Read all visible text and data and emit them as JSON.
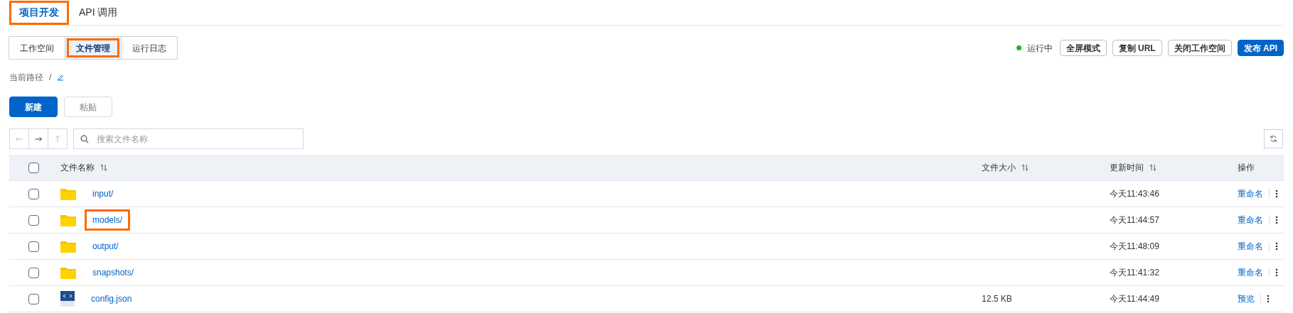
{
  "tabs": [
    {
      "label": "项目开发",
      "selected": true,
      "highlighted": true
    },
    {
      "label": "API 调用",
      "selected": false,
      "highlighted": false
    }
  ],
  "subtabs": [
    {
      "label": "工作空间",
      "selected": false,
      "highlighted": false
    },
    {
      "label": "文件管理",
      "selected": true,
      "highlighted": true
    },
    {
      "label": "运行日志",
      "selected": false,
      "highlighted": false
    }
  ],
  "status": {
    "label": "运行中",
    "color": "#1ab83a"
  },
  "actions": [
    {
      "label": "全屏模式",
      "kind": "default"
    },
    {
      "label": "复制 URL",
      "kind": "default"
    },
    {
      "label": "关闭工作空间",
      "kind": "default"
    },
    {
      "label": "发布 API",
      "kind": "primary"
    }
  ],
  "path": {
    "label": "当前路径",
    "value": "/"
  },
  "buttons": [
    {
      "label": "新建",
      "disabled": false
    },
    {
      "label": "粘贴",
      "disabled": true
    }
  ],
  "nav": [
    {
      "kind": "back",
      "disabled": true
    },
    {
      "kind": "forward",
      "disabled": false
    },
    {
      "kind": "up",
      "disabled": true
    }
  ],
  "search": {
    "placeholder": "搜索文件名称"
  },
  "table": {
    "all_checked": false,
    "columns": [
      "文件名称",
      "文件大小",
      "更新时间",
      "操作"
    ],
    "rows": [
      {
        "kind": "folder",
        "name": "input/",
        "time": "今天11:43:46",
        "action": "重命名",
        "checked": false,
        "highlighted": false
      },
      {
        "kind": "folder",
        "name": "models/",
        "time": "今天11:44:57",
        "action": "重命名",
        "checked": false,
        "highlighted": true
      },
      {
        "kind": "folder",
        "name": "output/",
        "time": "今天11:48:09",
        "action": "重命名",
        "checked": false,
        "highlighted": false
      },
      {
        "kind": "folder",
        "name": "snapshots/",
        "time": "今天11:41:32",
        "action": "重命名",
        "checked": false,
        "highlighted": false
      },
      {
        "kind": "file",
        "name": "config.json",
        "size": "12.5 KB",
        "time": "今天11:44:49",
        "action": "预览",
        "checked": false,
        "highlighted": false
      }
    ]
  }
}
